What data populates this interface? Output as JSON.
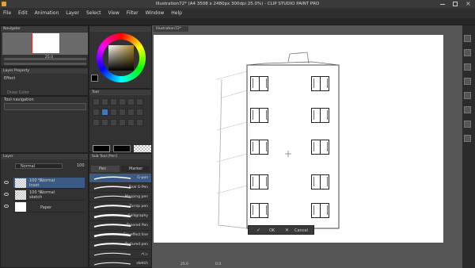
{
  "window": {
    "title": "Illustration72* (A4 3508 x 2480px 300dpi 25.0%) - CLIP STUDIO PAINT PRO"
  },
  "menu": [
    "File",
    "Edit",
    "Animation",
    "Layer",
    "Select",
    "View",
    "Filter",
    "Window",
    "Help"
  ],
  "navigator": {
    "tab": "Navigator",
    "zoom": "25.0"
  },
  "layer_property": {
    "tab": "Layer Property",
    "effect_label": "Effect",
    "draw_color_label": "Draw Color"
  },
  "tool_navigation": {
    "tab": "Tool navigation"
  },
  "tool_panel": {
    "tab": "Tool"
  },
  "sub_tool": {
    "tab": "Sub Tool [Pen]",
    "tabs": [
      "Pen",
      "Marker"
    ],
    "brushes": [
      "G-pen",
      "Real G-Pen",
      "Mapping pen",
      "Turnip pen",
      "Calligraphy",
      "Tapered Pen",
      "For effect line",
      "Textured pen",
      "ペン",
      "sketch"
    ]
  },
  "layer_panel": {
    "tab": "Layer",
    "blend_mode": "Normal",
    "opacity": "100",
    "layers": [
      {
        "opacity": "100 %",
        "mode": "Normal",
        "name": "Inset"
      },
      {
        "opacity": "100 %",
        "mode": "Normal",
        "name": "sketch"
      },
      {
        "opacity": "",
        "mode": "",
        "name": "Paper"
      }
    ]
  },
  "canvas": {
    "tab": "Illustration72*",
    "zoom": "25.0",
    "rotation": "0.0",
    "ok_label": "OK",
    "cancel_label": "Cancel"
  },
  "colors": {
    "bg": "#2b2b2b",
    "panel": "#323232",
    "accent": "#3b78c4",
    "canvas": "#ffffff"
  }
}
